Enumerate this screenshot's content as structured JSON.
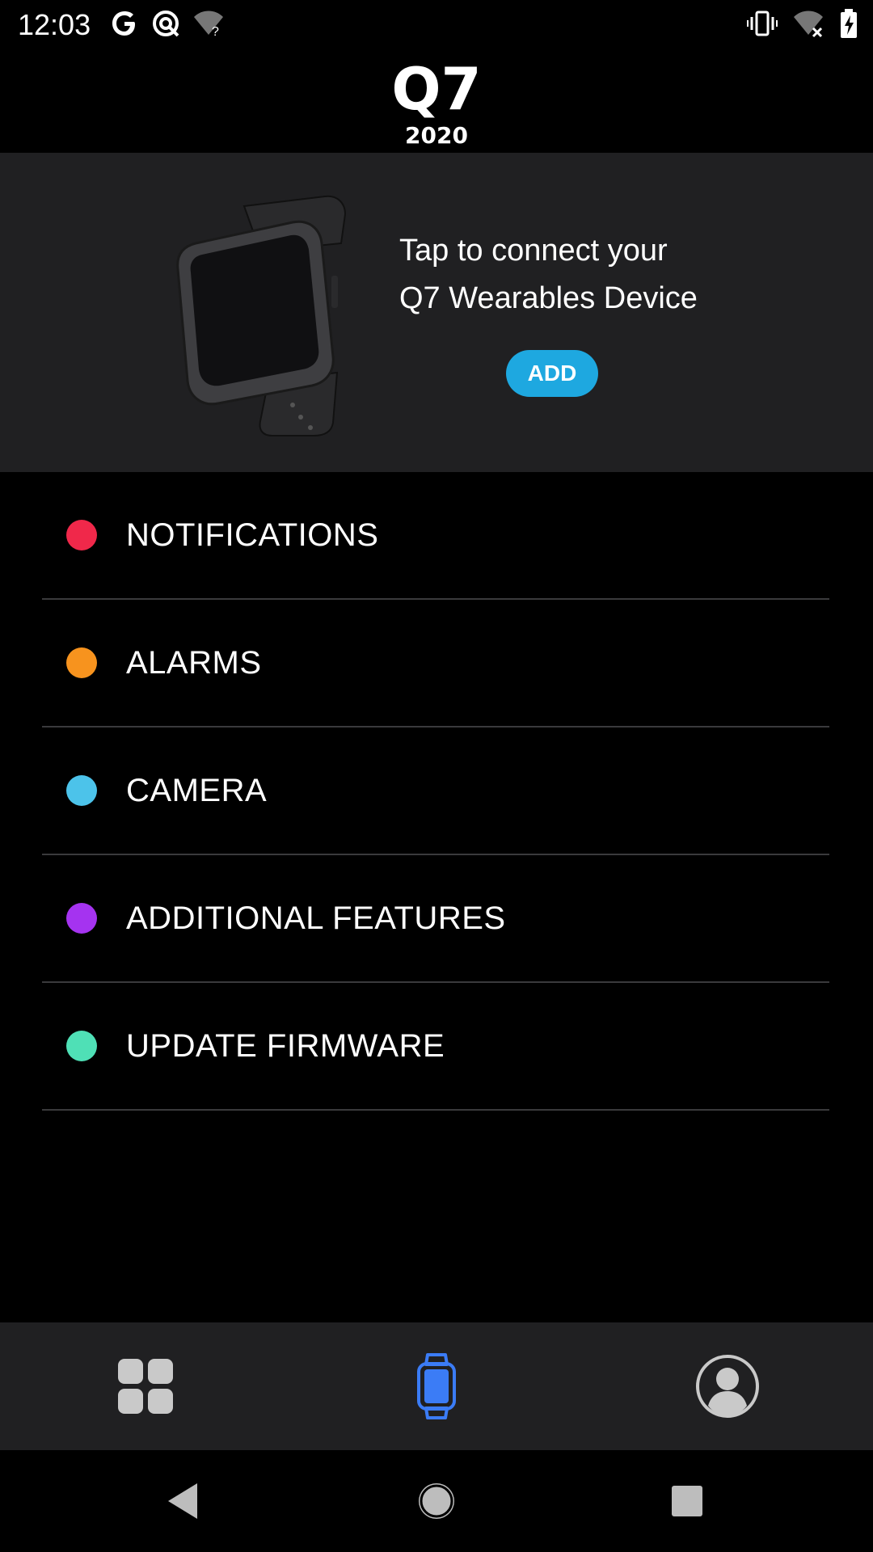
{
  "status_bar": {
    "time": "12:03",
    "icons_left": [
      "google-icon",
      "data-saver-icon",
      "wifi-unknown-icon"
    ],
    "icons_right": [
      "vibrate-icon",
      "wifi-off-icon",
      "battery-charging-icon"
    ]
  },
  "header": {
    "logo_text": "Q7",
    "logo_subtext": "2020"
  },
  "hero": {
    "connect_text_line1": "Tap to connect your",
    "connect_text_line2": "Q7 Wearables Device",
    "add_label": "ADD",
    "add_color": "#1ea8e0"
  },
  "menu": {
    "items": [
      {
        "label": "NOTIFICATIONS",
        "color": "#f0284a"
      },
      {
        "label": "ALARMS",
        "color": "#f7931e"
      },
      {
        "label": "CAMERA",
        "color": "#4cc3ea"
      },
      {
        "label": "ADDITIONAL FEATURES",
        "color": "#a533f0"
      },
      {
        "label": "UPDATE FIRMWARE",
        "color": "#4fe0b6"
      }
    ]
  },
  "bottom_nav": {
    "tabs": [
      {
        "icon": "apps-grid-icon",
        "active": false
      },
      {
        "icon": "watch-icon",
        "active": true
      },
      {
        "icon": "profile-icon",
        "active": false
      }
    ],
    "active_color": "#3b7cf6",
    "inactive_color": "#c9c9c9"
  },
  "system_nav": {
    "buttons": [
      "back-icon",
      "home-icon",
      "recents-icon"
    ]
  }
}
